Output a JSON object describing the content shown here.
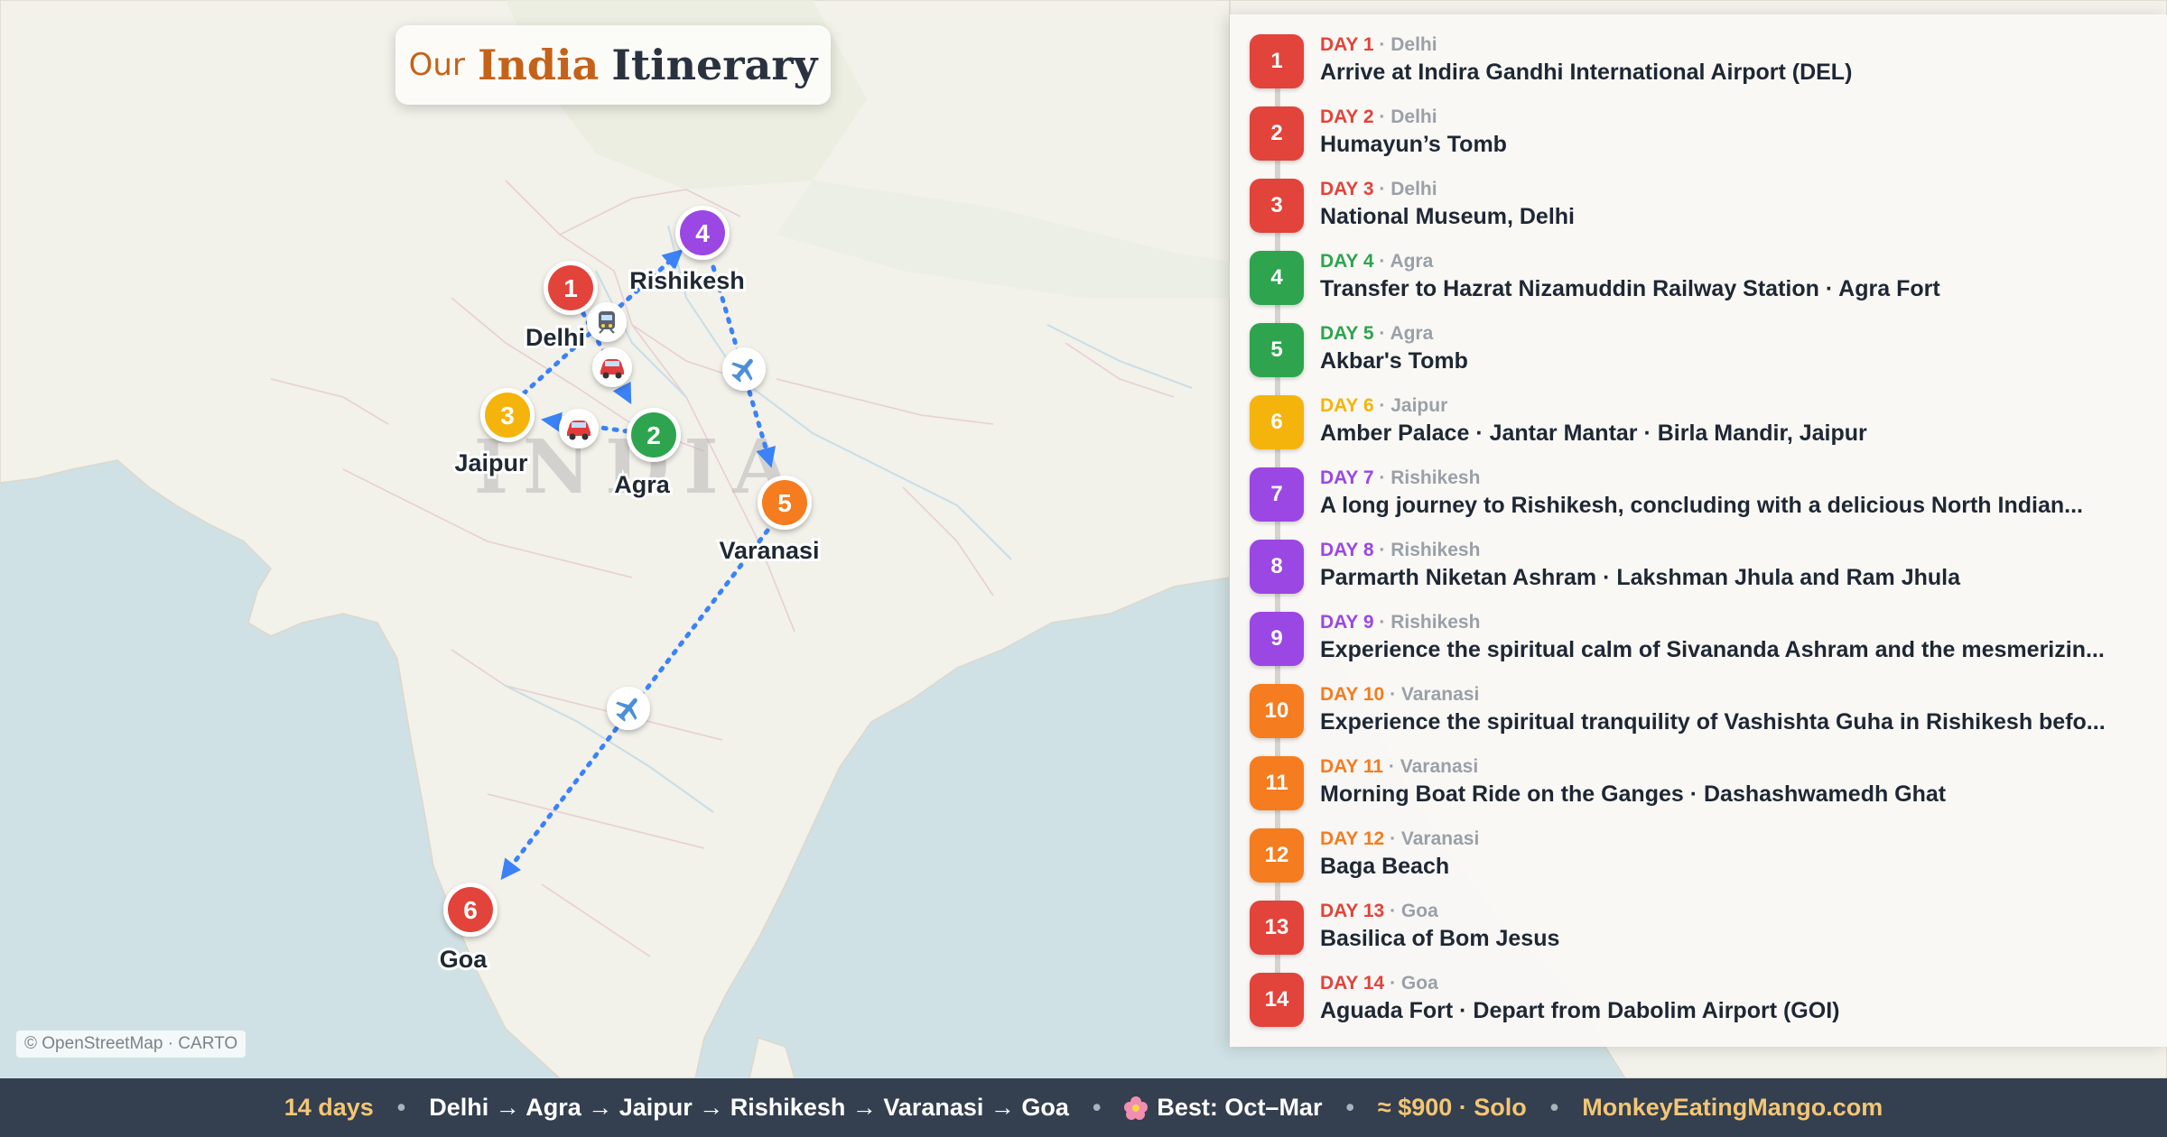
{
  "title": {
    "our": "Our",
    "india": "India",
    "itinerary": "Itinerary"
  },
  "map": {
    "country_label": "INDIA",
    "attribution": "© OpenStreetMap · CARTO",
    "stops": [
      {
        "n": "1",
        "name": "Delhi",
        "color": "#e2433a"
      },
      {
        "n": "2",
        "name": "Agra",
        "color": "#2ea44f"
      },
      {
        "n": "3",
        "name": "Jaipur",
        "color": "#f5b40c"
      },
      {
        "n": "4",
        "name": "Rishikesh",
        "color": "#9b47e3"
      },
      {
        "n": "5",
        "name": "Varanasi",
        "color": "#f57c1f"
      },
      {
        "n": "6",
        "name": "Goa",
        "color": "#e2433a"
      }
    ],
    "transport_icons": [
      "train-icon",
      "car-icon",
      "car-icon",
      "plane-icon",
      "plane-icon"
    ]
  },
  "days": [
    {
      "n": "1",
      "label": "DAY 1",
      "city": "Delhi",
      "title": "Arrive at Indira Gandhi International Airport (DEL)",
      "color": "#e2433a"
    },
    {
      "n": "2",
      "label": "DAY 2",
      "city": "Delhi",
      "title": "Humayun’s Tomb",
      "color": "#e2433a"
    },
    {
      "n": "3",
      "label": "DAY 3",
      "city": "Delhi",
      "title": "National Museum, Delhi",
      "color": "#e2433a"
    },
    {
      "n": "4",
      "label": "DAY 4",
      "city": "Agra",
      "title": "Transfer to Hazrat Nizamuddin Railway Station · Agra Fort",
      "color": "#2ea44f"
    },
    {
      "n": "5",
      "label": "DAY 5",
      "city": "Agra",
      "title": "Akbar's Tomb",
      "color": "#2ea44f"
    },
    {
      "n": "6",
      "label": "DAY 6",
      "city": "Jaipur",
      "title": "Amber Palace · Jantar Mantar · Birla Mandir, Jaipur",
      "color": "#f5b40c"
    },
    {
      "n": "7",
      "label": "DAY 7",
      "city": "Rishikesh",
      "title": "A long journey to Rishikesh, concluding with a delicious North Indian...",
      "color": "#9b47e3"
    },
    {
      "n": "8",
      "label": "DAY 8",
      "city": "Rishikesh",
      "title": "Parmarth Niketan Ashram · Lakshman Jhula and Ram Jhula",
      "color": "#9b47e3"
    },
    {
      "n": "9",
      "label": "DAY 9",
      "city": "Rishikesh",
      "title": "Experience the spiritual calm of Sivananda Ashram and the mesmerizin...",
      "color": "#9b47e3"
    },
    {
      "n": "10",
      "label": "DAY 10",
      "city": "Varanasi",
      "title": "Experience the spiritual tranquility of Vashishta Guha in Rishikesh befo...",
      "color": "#f57c1f"
    },
    {
      "n": "11",
      "label": "DAY 11",
      "city": "Varanasi",
      "title": "Morning Boat Ride on the Ganges · Dashashwamedh Ghat",
      "color": "#f57c1f"
    },
    {
      "n": "12",
      "label": "DAY 12",
      "city": "Varanasi",
      "title": "Baga Beach",
      "color": "#f57c1f"
    },
    {
      "n": "13",
      "label": "DAY 13",
      "city": "Goa",
      "title": "Basilica of Bom Jesus",
      "color": "#e2433a"
    },
    {
      "n": "14",
      "label": "DAY 14",
      "city": "Goa",
      "title": "Aguada Fort · Depart from Dabolim Airport (GOI)",
      "color": "#e2433a"
    }
  ],
  "footer": {
    "duration": "14 days",
    "route": "Delhi → Agra → Jaipur → Rishikesh → Varanasi → Goa",
    "season": "Best: Oct–Mar",
    "budget": "≈ $900 · Solo",
    "site": "MonkeyEatingMango.com",
    "separator": "•"
  }
}
